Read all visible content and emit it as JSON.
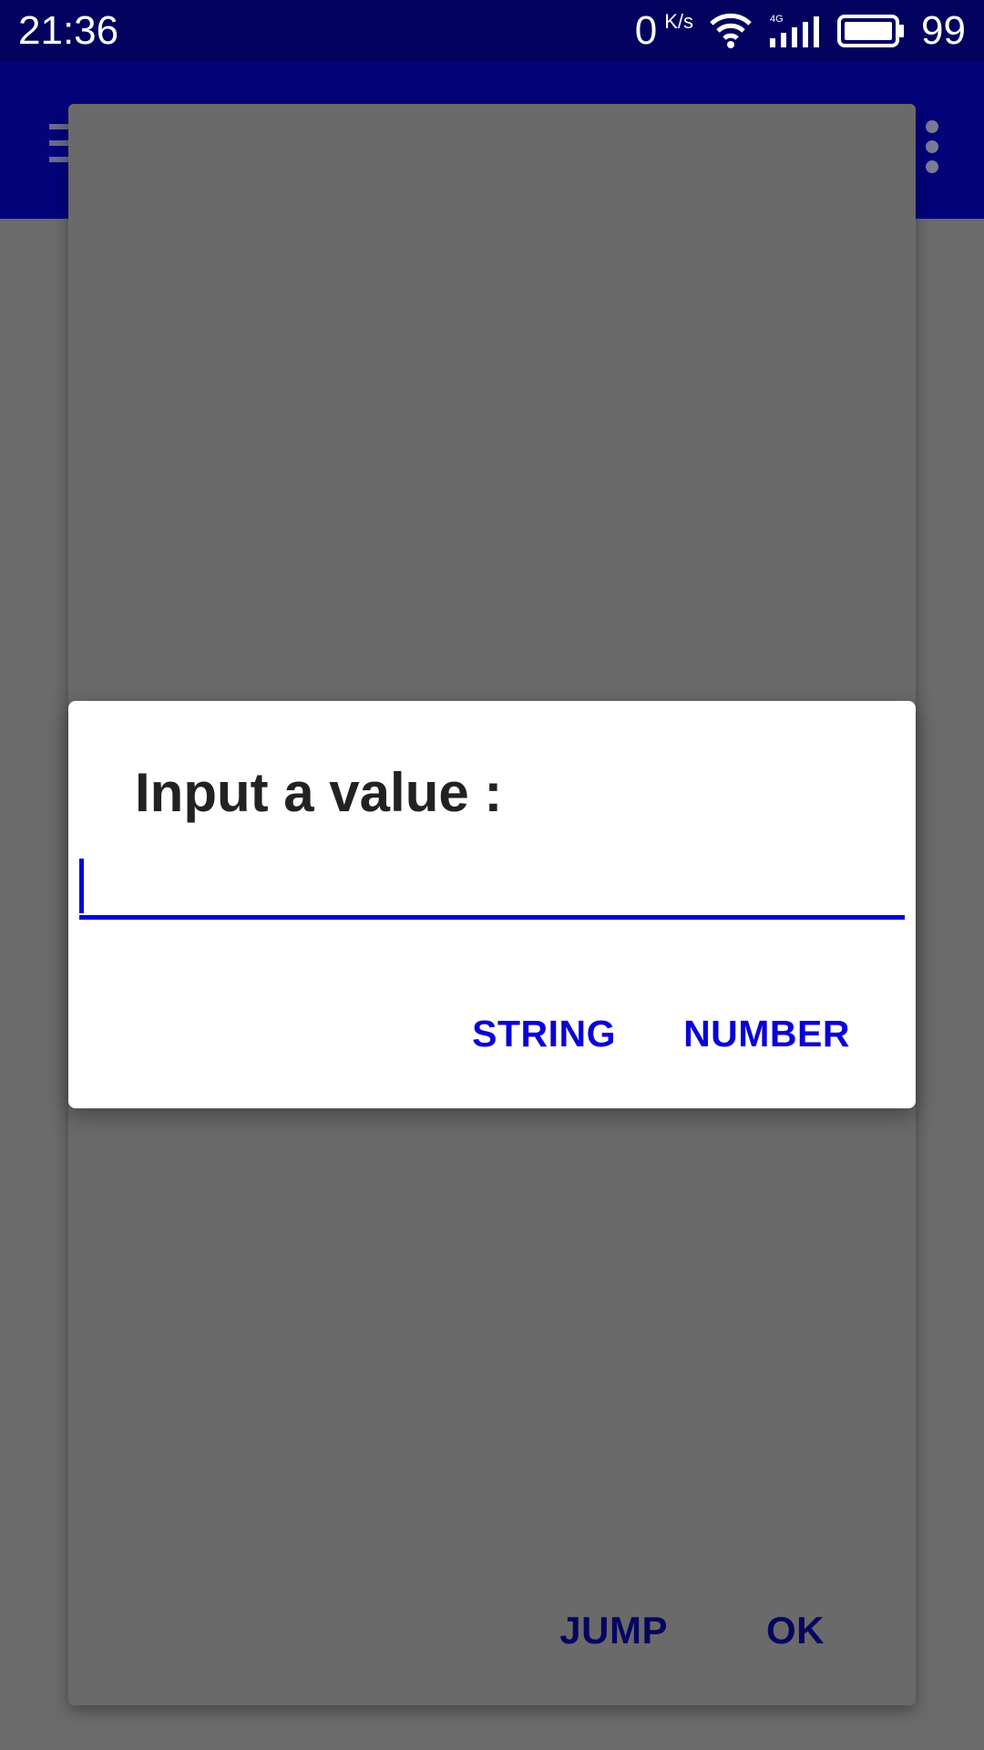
{
  "status_bar": {
    "time": "21:36",
    "net_speed": "0",
    "net_speed_unit": "K/s",
    "network_type": "4G",
    "battery": "99"
  },
  "outer_dialog": {
    "jump_label": "JUMP",
    "ok_label": "OK"
  },
  "input_dialog": {
    "title": "Input a value :",
    "value": "",
    "string_label": "STRING",
    "number_label": "NUMBER"
  },
  "colors": {
    "status_bar": "#03035f",
    "toolbar": "#03037a",
    "accent": "#0b00d6",
    "dim_overlay": "#6b6b6b",
    "dialog_bg": "#ffffff"
  },
  "icons": [
    "wifi-icon",
    "signal-icon",
    "battery-icon",
    "menu-icon",
    "overflow-menu-icon"
  ]
}
